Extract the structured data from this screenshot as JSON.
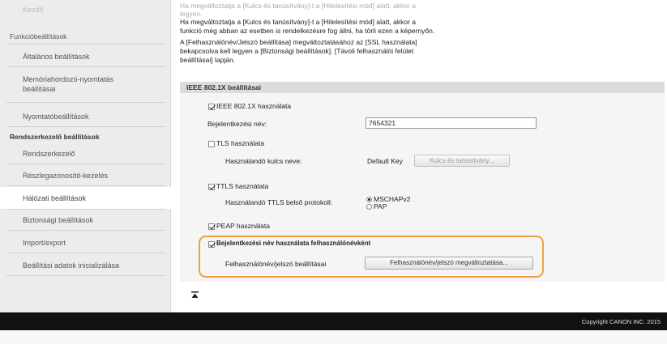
{
  "sidebar": {
    "top_item": "Kezdő",
    "group1": "Funkcióbeállítások",
    "items1": [
      "Általános beállítások",
      "Memóriahordozó-nyomtatás\nbeállításai",
      "Nyomtatóbeállítások"
    ],
    "group2": "Rendszerkezelő beállítások",
    "items2": [
      "Rendszerkezelő",
      "Részlegazonosító-kezelés",
      "Hálózati beállítások",
      "Biztonsági beállítások",
      "Import/export",
      "Beállítási adatok inicializálása"
    ],
    "active_item": "Hálózati beállítások"
  },
  "info": {
    "faded_line1": "Ha megváltoztatja a [Kulcs és tanúsítvány]-t a [Hitelesítési mód] alatt, akkor a",
    "faded_line2": "legyen.",
    "line1": "Ha megváltoztatja a [Kulcs és tanúsítvány]-t a [Hitelesítési mód] alatt, akkor a",
    "line2": "funkció még abban az esetben is rendelkezésre fog állni, ha törli ezen a képernyőn.",
    "line3": "A [Felhasználónév/Jelszó beállítása] megváltoztatásához az [SSL használata]",
    "line4": "bekapcsolva kell legyen a [Biztonsági beállítások]. [Távoli felhasználói felület",
    "line5": "beállításai] lapján."
  },
  "section": {
    "header": "IEEE 802.1X beállításai",
    "use_ieee": "IEEE 802.1X használata",
    "login_name_label": "Bejelentkezési név:",
    "login_name_value": "7654321",
    "use_tls": "TLS használata",
    "tls_key_label": "Használandó kulcs neve:",
    "tls_key_value": "Default Key",
    "tls_key_button": "Kulcs és tanúsítvány...",
    "use_ttls": "TTLS használata",
    "ttls_protocol_label": "Használandó TTLS belső protokoll:",
    "ttls_opt1": "MSCHAPv2",
    "ttls_opt2": "PAP",
    "use_peap": "PEAP használata",
    "use_login_as_user": "Bejelentkezési név használata felhasználónévként",
    "user_pass_label": "Felhasználónév/jelszó beállításai",
    "user_pass_button": "Felhasználónév/jelszó megváltoztatása..."
  },
  "footer": {
    "copyright": "Copyright CANON INC. 2015"
  },
  "colors": {
    "highlight": "#f0a040",
    "footer_bg": "#111111"
  }
}
